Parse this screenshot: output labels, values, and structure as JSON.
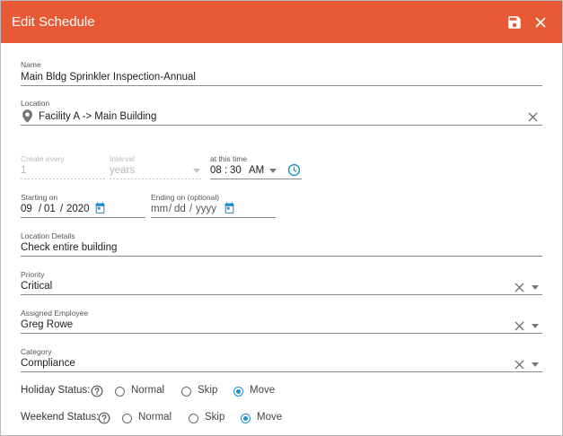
{
  "header": {
    "title": "Edit Schedule"
  },
  "name": {
    "label": "Name",
    "value": "Main Bldg Sprinkler Inspection-Annual"
  },
  "location": {
    "label": "Location",
    "value": "Facility A -> Main Building"
  },
  "recurrence": {
    "create_every_label": "Create every",
    "create_every_value": "1",
    "interval_label": "Interval",
    "interval_value": "years",
    "time_label": "at this time",
    "hour": "08",
    "minute": "30",
    "ampm": "AM"
  },
  "starting": {
    "label": "Starting on",
    "month": "09",
    "day": "01",
    "year": "2020"
  },
  "ending": {
    "label": "Ending on (optional)",
    "month": "mm",
    "day": "dd",
    "year": "yyyy"
  },
  "location_details": {
    "label": "Location Details",
    "value": "Check entire building"
  },
  "priority": {
    "label": "Priority",
    "value": "Critical"
  },
  "assigned_employee": {
    "label": "Assigned Employee",
    "value": "Greg Rowe"
  },
  "category": {
    "label": "Category",
    "value": "Compliance"
  },
  "holiday_status": {
    "label": "Holiday Status:",
    "options": [
      "Normal",
      "Skip",
      "Move"
    ],
    "selected": "Move"
  },
  "weekend_status": {
    "label": "Weekend Status:",
    "options": [
      "Normal",
      "Skip",
      "Move"
    ],
    "selected": "Move"
  },
  "colors": {
    "header": "#e85a35",
    "accent": "#1a8fc9"
  }
}
